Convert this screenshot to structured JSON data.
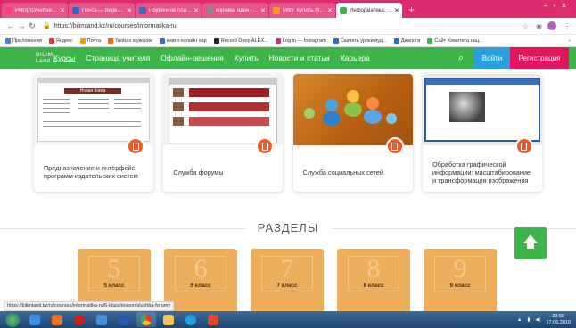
{
  "browser": {
    "tabs": [
      {
        "title": "РНП(Л)Учебник - Almu",
        "color": "#f0a"
      },
      {
        "title": "Почта — begezhayeva",
        "color": "#2b6cc4"
      },
      {
        "title": "Поурочное планирова",
        "color": "#3a6ec4"
      },
      {
        "title": "корзина идей - Поиск",
        "color": "#888"
      },
      {
        "title": "МФУ. Купить МФУ (вкл",
        "color": "#f39a1e"
      },
      {
        "title": "Информатика: уроки и",
        "color": "#3cb44a",
        "active": true
      }
    ],
    "url": "https://bilimland.kz/ru/courses/informatika-ru",
    "bookmarks": [
      {
        "label": "Приложения",
        "color": "#4a7bd6"
      },
      {
        "label": "Яндекс",
        "color": "#e33"
      },
      {
        "label": "Почта",
        "color": "#f0a000"
      },
      {
        "label": "Taobao мужские",
        "color": "#f60"
      },
      {
        "label": "книги онлайн хар",
        "color": "#3a6ec4"
      },
      {
        "label": "Record Deep ALEX...",
        "color": "#222"
      },
      {
        "label": "Log in — Instagram",
        "color": "#c13584"
      },
      {
        "label": "Скачать уроки вуд...",
        "color": "#2b6cc4"
      },
      {
        "label": "Диалоги",
        "color": "#2b6cc4"
      },
      {
        "label": "Сайт Комитета нац...",
        "color": "#4caf50"
      }
    ]
  },
  "site": {
    "logo_line1": "BILIM",
    "logo_line2": "Land",
    "nav": [
      "Курсы",
      "Страница учителя",
      "Офлайн-решения",
      "Купить",
      "Новости и статьи",
      "Карьера"
    ],
    "login": "Войти",
    "register": "Регистрация",
    "header_color": "#3cb44a"
  },
  "cards": [
    {
      "title": "Предназначение и интерфейс программ издательских систем",
      "thumb": "Новая Книга"
    },
    {
      "title": "Служба форумы"
    },
    {
      "title": "Служба социальных сетей"
    },
    {
      "title": "Обработка графической информации: масштабирование и трансформация изображения"
    }
  ],
  "sections_title": "РАЗДЕЛЫ",
  "grades": [
    {
      "num": "5",
      "label": "5 класс"
    },
    {
      "num": "6",
      "label": "6 класс"
    },
    {
      "num": "7",
      "label": "7 класс"
    },
    {
      "num": "8",
      "label": "8 класс"
    },
    {
      "num": "9",
      "label": "9 класс"
    }
  ],
  "status_url": "https://bilimland.kz/ru/courses/informatika-ru/6-klass/lesson/sluzhba-forumy",
  "taskbar": {
    "time": "23:59",
    "date": "17.06.2019"
  }
}
